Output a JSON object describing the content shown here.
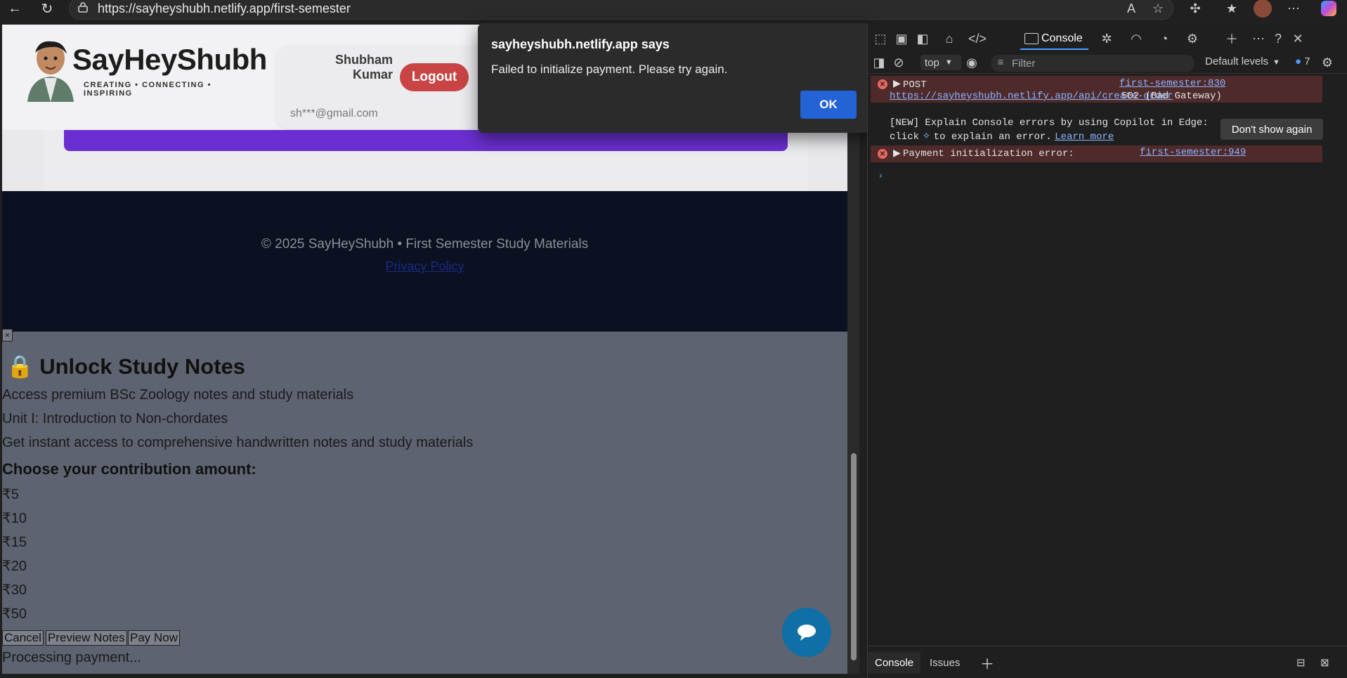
{
  "browser": {
    "url": "https://sayheyshubh.netlify.app/first-semester"
  },
  "site": {
    "logo_title": "SayHeyShubh",
    "logo_tagline": "CREATING • CONNECTING • INSPIRING",
    "user_name": "Shubham Kumar",
    "user_email": "sh***@gmail.com",
    "logout_label": "Logout",
    "footer_copy": "© 2025 SayHeyShubh • First Semester Study Materials",
    "footer_privacy": "Privacy Policy"
  },
  "modal": {
    "close_label": "×",
    "title": "🔒 Unlock Study Notes",
    "lines": [
      "Access premium BSc Zoology notes and study materials",
      "Unit I: Introduction to Non-chordates",
      "Get instant access to comprehensive handwritten notes and study materials"
    ],
    "choose_label": "Choose your contribution amount:",
    "amounts": [
      "₹5",
      "₹10",
      "₹15",
      "₹20",
      "₹30",
      "₹50"
    ],
    "cancel_label": "Cancel",
    "preview_label": "Preview Notes",
    "pay_label": "Pay Now",
    "status": "Processing payment..."
  },
  "alert": {
    "title": "sayheyshubh.netlify.app says",
    "message": "Failed to initialize payment. Please try again.",
    "ok_label": "OK"
  },
  "devtools": {
    "console_tab": "Console",
    "context": "top",
    "filter_placeholder": "Filter",
    "levels": "Default levels",
    "badge_count": "7",
    "error1_method": "POST",
    "error1_url": "https://sayheyshubh.netlify.app/api/create-order",
    "error1_status": "502 (Bad Gateway)",
    "error1_source": "first-semester:830",
    "copilot_line1": "[NEW] Explain Console errors by using Copilot in Edge:",
    "copilot_line2_a": "click",
    "copilot_line2_b": "to explain an error.",
    "copilot_learn": "Learn more",
    "dont_show": "Don't show again",
    "error2_text": "Payment initialization error:",
    "error2_source": "first-semester:949",
    "bottom_console": "Console",
    "bottom_issues": "Issues"
  },
  "colors": {
    "accent_purple": "#6a2fd0",
    "logout_red": "#c94545",
    "ok_blue": "#2463d6",
    "fab_blue": "#0f6fa6",
    "error_bg": "#4e2a2a"
  }
}
